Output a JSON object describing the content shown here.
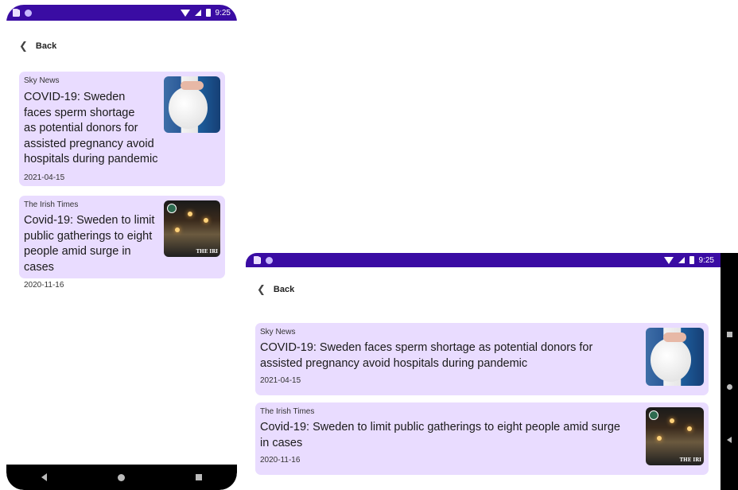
{
  "status_bar": {
    "time": "9:25"
  },
  "back_label": "Back",
  "articles": [
    {
      "source": "Sky News",
      "title": "COVID-19: Sweden faces sperm shortage as potential donors for assisted pregnancy avoid hospitals during pandemic",
      "date": "2021-04-15",
      "image_icon": "pregnancy-photo"
    },
    {
      "source": "The Irish Times",
      "title": "Covid-19: Sweden to limit public gatherings to eight people amid surge in cases",
      "date": "2020-11-16",
      "image_icon": "street-scene-photo",
      "image_watermark": "THE IRI"
    }
  ],
  "portrait_titles": [
    [
      "COVID-19: Sweden",
      "faces sperm shortage",
      "as potential donors for",
      "assisted pregnancy avoid",
      "hospitals during pandemic"
    ],
    [
      "Covid-19: Sweden to limit",
      "public gatherings to eight",
      "people amid surge in cases"
    ]
  ],
  "landscape_titles": [
    [
      "COVID-19: Sweden faces sperm shortage as potential donors for",
      "assisted pregnancy avoid hospitals during pandemic"
    ],
    [
      "Covid-19: Sweden to limit public gatherings to eight people amid surge",
      "in cases"
    ]
  ],
  "colors": {
    "status_bar": "#3a0ca3",
    "card_background": "#e9dcff",
    "nav_bar": "#000000"
  }
}
